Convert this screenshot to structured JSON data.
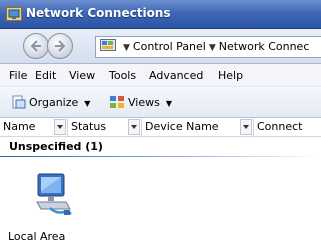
{
  "window": {
    "title": "Network Connections",
    "title_icon": "network-connections-icon"
  },
  "nav": {
    "back_icon": "back-arrow-icon",
    "forward_icon": "forward-arrow-icon"
  },
  "address": {
    "icon": "control-panel-icon",
    "segments": [
      "Control Panel",
      "Network Connec"
    ]
  },
  "menu": [
    "File",
    "Edit",
    "View",
    "Tools",
    "Advanced",
    "Help"
  ],
  "toolbar": {
    "organize_label": "Organize",
    "views_label": "Views"
  },
  "columns": [
    "Name",
    "Status",
    "Device Name",
    "Connect"
  ],
  "group": {
    "label": "Unspecified (1)"
  },
  "items": [
    {
      "label": "Local Area",
      "icon": "network-adapter-icon"
    }
  ],
  "colors": {
    "titlebar": "#3f67b4",
    "group_line": "#2d5caf"
  }
}
